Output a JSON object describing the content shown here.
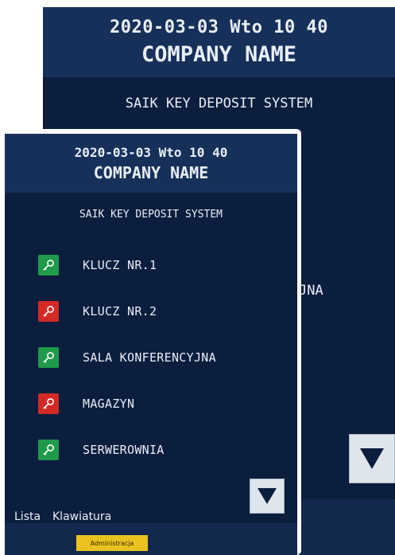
{
  "back_screen": {
    "datetime": "2020-03-03 Wto 10 40",
    "company": "COMPANY NAME",
    "system": "SAIK KEY DEPOSIT SYSTEM",
    "partial_text": "JNA"
  },
  "front_screen": {
    "datetime": "2020-03-03 Wto 10 40",
    "company": "COMPANY NAME",
    "system": "SAIK KEY DEPOSIT SYSTEM",
    "keys": [
      {
        "label": "KLUCZ NR.1",
        "status": "available",
        "color": "#1f9a4a",
        "icon": "key-icon"
      },
      {
        "label": "KLUCZ NR.2",
        "status": "taken",
        "color": "#d32a26",
        "icon": "key-icon"
      },
      {
        "label": "SALA KONFERENCYJNA",
        "status": "available",
        "color": "#1f9a4a",
        "icon": "key-icon"
      },
      {
        "label": "MAGAZYN",
        "status": "taken",
        "color": "#d32a26",
        "icon": "key-icon"
      },
      {
        "label": "SERWEROWNIA",
        "status": "available",
        "color": "#1f9a4a",
        "icon": "key-icon"
      }
    ],
    "tabs": {
      "list": "Lista",
      "keyboard": "Klawiatura"
    },
    "admin_button": "Administracja"
  },
  "colors": {
    "background": "#0c1e3e",
    "header": "#17305a",
    "available": "#1f9a4a",
    "taken": "#d32a26",
    "admin": "#e9c21f"
  }
}
